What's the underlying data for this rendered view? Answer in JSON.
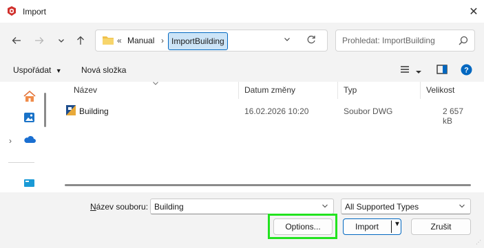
{
  "window": {
    "title": "Import",
    "app_icon": "sketchup-icon",
    "close_label": "✕"
  },
  "nav": {
    "back_icon": "arrow-left-icon",
    "forward_icon": "arrow-right-icon",
    "recent_icon": "chevron-down-icon",
    "up_icon": "arrow-up-icon"
  },
  "address": {
    "overflow": "«",
    "crumbs": [
      "Manual",
      "ImportBuilding"
    ],
    "separator": "›"
  },
  "search": {
    "placeholder": "Prohledat: ImportBuilding"
  },
  "toolbar": {
    "organize_label": "Uspořádat",
    "new_folder_label": "Nová složka"
  },
  "columns": {
    "name": "Název",
    "date": "Datum změny",
    "type": "Typ",
    "size": "Velikost"
  },
  "files": [
    {
      "name": "Building",
      "date": "16.02.2026 10:20",
      "type": "Soubor DWG",
      "size": "2 657 kB"
    }
  ],
  "bottom": {
    "filename_label_n": "N",
    "filename_label_rest": "ázev souboru:",
    "filename_value": "Building",
    "filetype_value": "All Supported Types",
    "options_label": "Options...",
    "import_label": "Import",
    "cancel_label": "Zrušit"
  },
  "colors": {
    "accent": "#0067c0",
    "highlight": "#22e31f",
    "sketchup_red": "#d0312d"
  }
}
